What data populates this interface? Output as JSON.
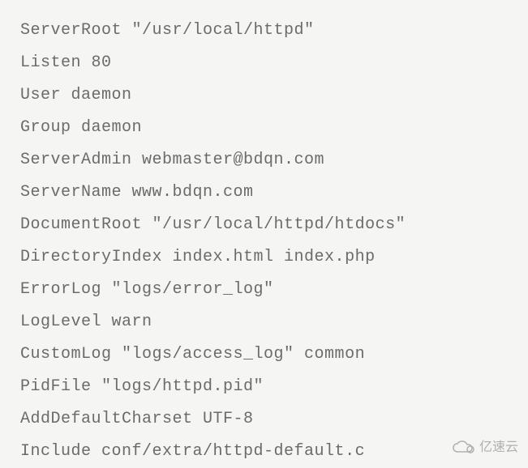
{
  "config_lines": [
    "ServerRoot \"/usr/local/httpd\"",
    "Listen 80",
    "User daemon",
    "Group daemon",
    "ServerAdmin webmaster@bdqn.com",
    "ServerName www.bdqn.com",
    "DocumentRoot \"/usr/local/httpd/htdocs\"",
    "DirectoryIndex index.html index.php",
    "ErrorLog \"logs/error_log\"",
    "LogLevel warn",
    "CustomLog \"logs/access_log\" common",
    "PidFile \"logs/httpd.pid\"",
    "AddDefaultCharset UTF-8",
    "Include conf/extra/httpd-default.c"
  ],
  "watermark": {
    "text": "亿速云"
  }
}
